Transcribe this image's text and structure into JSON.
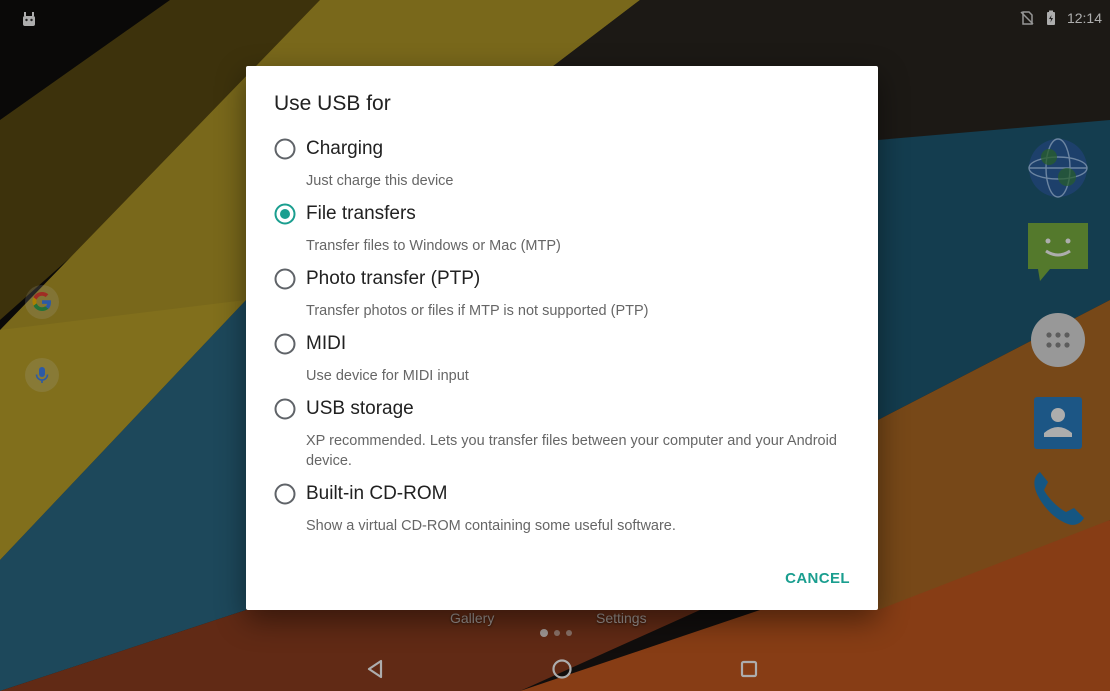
{
  "status_bar": {
    "time": "12:14",
    "left_icon": "android-debug-icon",
    "right_icons": [
      "no-sim-icon",
      "battery-charging-icon"
    ]
  },
  "home": {
    "left_icons": [
      "google-search-icon",
      "voice-search-icon"
    ],
    "right_apps": [
      "browser-globe-icon",
      "messaging-icon",
      "app-drawer-icon",
      "contacts-icon",
      "phone-icon"
    ],
    "dock_labels": {
      "gallery": "Gallery",
      "settings": "Settings"
    },
    "page_dots": 3,
    "active_page": 0
  },
  "nav_bar": {
    "back": "back-icon",
    "home": "home-icon",
    "recents": "recents-icon"
  },
  "dialog": {
    "title": "Use USB for",
    "options": [
      {
        "label": "Charging",
        "description": "Just charge this device",
        "selected": false
      },
      {
        "label": "File transfers",
        "description": "Transfer files to Windows or Mac (MTP)",
        "selected": true
      },
      {
        "label": "Photo transfer (PTP)",
        "description": "Transfer photos or files if MTP is not supported (PTP)",
        "selected": false
      },
      {
        "label": "MIDI",
        "description": "Use device for MIDI input",
        "selected": false
      },
      {
        "label": "USB storage",
        "description": "XP recommended. Lets you transfer files between your computer and your Android device.",
        "selected": false
      },
      {
        "label": "Built-in CD-ROM",
        "description": "Show a virtual CD-ROM containing some useful software.",
        "selected": false
      }
    ],
    "cancel_label": "CANCEL"
  },
  "colors": {
    "accent": "#1a9e8f",
    "dialog_bg": "#ffffff",
    "label_text": "#212121",
    "description_text": "#666666",
    "radio_unselected": "#5f6368"
  }
}
